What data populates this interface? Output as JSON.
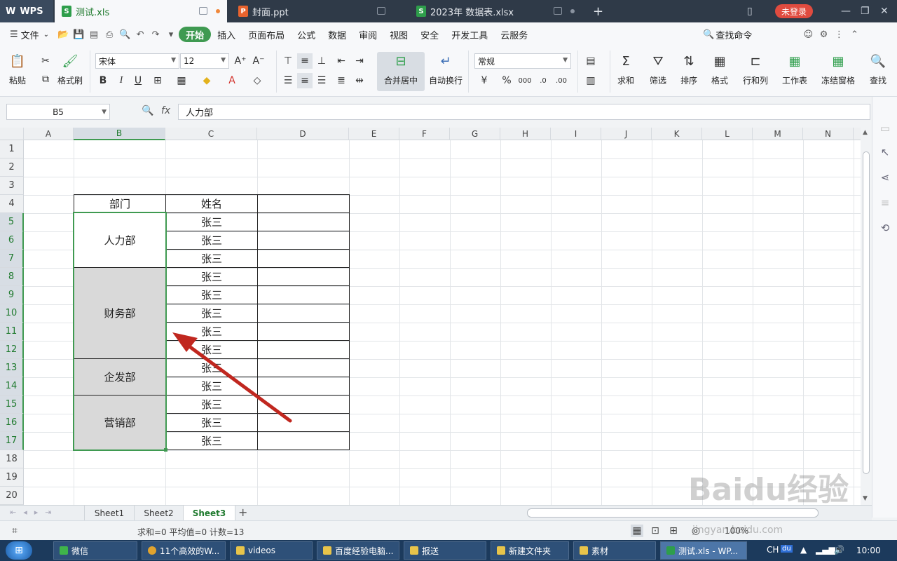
{
  "tabs": {
    "wps": "WPS",
    "items": [
      {
        "label": "测试.xls",
        "type": "S",
        "color": "#2e9e4b"
      },
      {
        "label": "封面.ppt",
        "type": "P",
        "color": "#e8632e"
      },
      {
        "label": "2023年 数据表.xlsx",
        "type": "S",
        "color": "#2e9e4b"
      }
    ],
    "login": "未登录"
  },
  "menu": {
    "file": "文件",
    "items": [
      "开始",
      "插入",
      "页面布局",
      "公式",
      "数据",
      "审阅",
      "视图",
      "安全",
      "开发工具",
      "云服务"
    ],
    "search": "查找命令"
  },
  "ribbon": {
    "paste": "粘贴",
    "format_painter": "格式刷",
    "font_name": "宋体",
    "font_size": "12",
    "merge_center": "合并居中",
    "wrap_text": "自动换行",
    "number_format": "常规",
    "sum": "求和",
    "filter": "筛选",
    "sort": "排序",
    "format": "格式",
    "row_col": "行和列",
    "worksheet": "工作表",
    "freeze": "冻结窗格",
    "find": "查找",
    "bold": "B",
    "italic": "I",
    "underline": "U",
    "percent": "%"
  },
  "formula_bar": {
    "name_box": "B5",
    "fx": "fx",
    "content": "人力部"
  },
  "sheet": {
    "columns": [
      "A",
      "B",
      "C",
      "D",
      "E",
      "F",
      "G",
      "H",
      "I",
      "J",
      "K",
      "L",
      "M",
      "N"
    ],
    "rows": [
      "1",
      "2",
      "3",
      "4",
      "5",
      "6",
      "7",
      "8",
      "9",
      "10",
      "11",
      "12",
      "13",
      "14",
      "15",
      "16",
      "17",
      "18",
      "19",
      "20"
    ],
    "header_dept": "部门",
    "header_name": "姓名",
    "departments": [
      "人力部",
      "财务部",
      "企发部",
      "营销部"
    ],
    "names": [
      "张三",
      "张三",
      "张三",
      "张三",
      "张三",
      "张三",
      "张三",
      "张三",
      "张三",
      "张三",
      "张三",
      "张三",
      "张三"
    ]
  },
  "sheet_tabs": [
    "Sheet1",
    "Sheet2",
    "Sheet3"
  ],
  "status": {
    "text": "求和=0  平均值=0  计数=13",
    "zoom": "100%"
  },
  "taskbar": {
    "items": [
      "微信",
      "11个高效的W...",
      "videos",
      "百度经验电脑...",
      "报送",
      "新建文件夹",
      "素材",
      "测试.xls - WP..."
    ],
    "tray_ime": "CH",
    "clock": "10:00"
  },
  "watermark": {
    "logo": "Baidu经验",
    "url": "jingyan.baidu.com"
  },
  "colors": {
    "accent": "#3f9a51",
    "arrow": "#c0271f",
    "merged_fill": "#d9d9d9"
  }
}
